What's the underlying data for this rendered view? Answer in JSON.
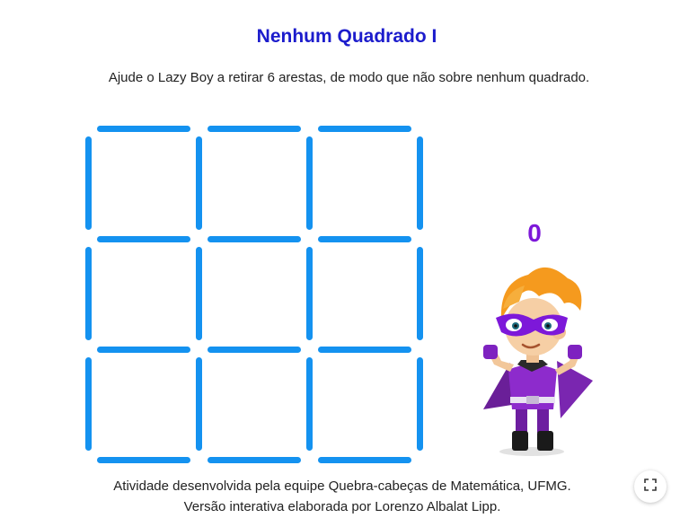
{
  "title": "Nenhum Quadrado I",
  "subtitle": "Ajude o Lazy Boy a retirar 6 arestas, de modo que não sobre nenhum quadrado.",
  "counter": "0",
  "footer": {
    "line1": "Atividade desenvolvida pela equipe Quebra-cabeças de Matemática, UFMG.",
    "line2": "Versão interativa elaborada por Lorenzo Albalat Lipp."
  },
  "board": {
    "rows": 3,
    "cols": 3,
    "stick_color": "#1492f0"
  },
  "colors": {
    "title": "#1c1ccc",
    "counter": "#7d18d9"
  },
  "icons": {
    "fullscreen": "fullscreen-icon",
    "character": "superhero-lazy-boy"
  }
}
